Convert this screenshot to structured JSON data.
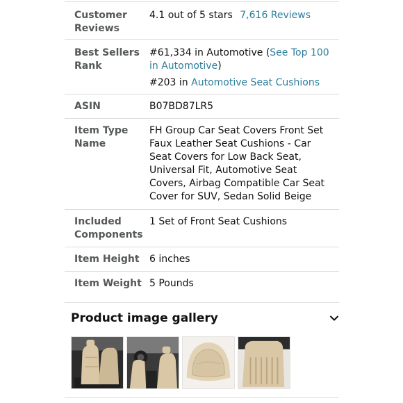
{
  "details": {
    "customer_reviews": {
      "label": "Customer Reviews",
      "stars_text": "4.1 out of 5 stars",
      "reviews_link": "7,616 Reviews"
    },
    "best_sellers_rank": {
      "label": "Best Sellers Rank",
      "rank_main_prefix": "#61,334 in Automotive (",
      "rank_main_link": "See Top 100 in Automotive",
      "rank_main_suffix": ")",
      "rank_sub_prefix": "#203 in ",
      "rank_sub_link": "Automotive Seat Cushions"
    },
    "asin": {
      "label": "ASIN",
      "value": "B07BD87LR5"
    },
    "item_type_name": {
      "label": "Item Type Name",
      "value": "FH Group Car Seat Covers Front Set Faux Leather Seat Cushions - Car Seat Covers for Low Back Seat, Universal Fit, Automotive Seat Covers, Airbag Compatible Car Seat Cover for SUV, Sedan Solid Beige"
    },
    "included_components": {
      "label": "Included Components",
      "value": "1 Set of Front Seat Cushions"
    },
    "item_height": {
      "label": "Item Height",
      "value": "6 inches"
    },
    "item_weight": {
      "label": "Item Weight",
      "value": "5 Pounds"
    }
  },
  "gallery": {
    "title": "Product image gallery",
    "toggle_icon": "chevron-down-icon",
    "thumbnails": [
      "seat-front-view-image",
      "car-interior-seats-image",
      "seat-cushion-closeup-image",
      "seat-side-view-image"
    ]
  },
  "colors": {
    "link": "#2d7d9a",
    "label": "#565959",
    "text": "#0f1111",
    "divider": "#dddddd",
    "beige": "#d9c7a6"
  }
}
